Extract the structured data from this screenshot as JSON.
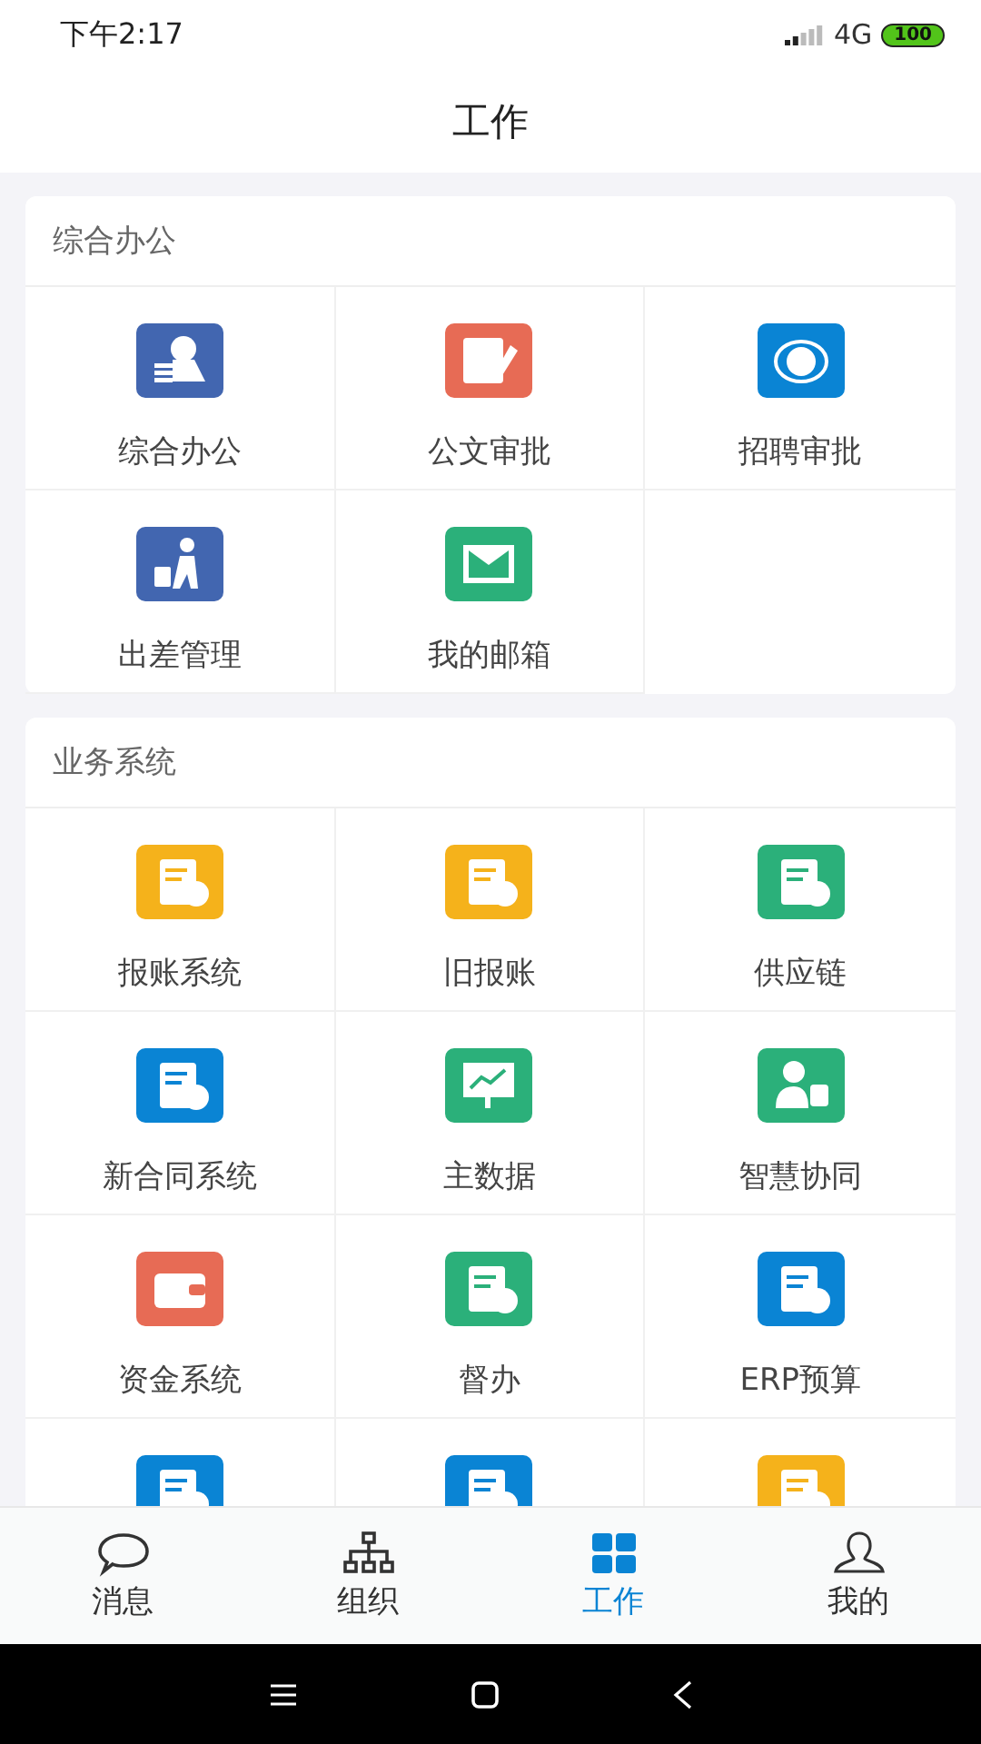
{
  "status_bar": {
    "time": "下午2:17",
    "network": "4G",
    "battery": "100"
  },
  "header": {
    "title": "工作"
  },
  "sections": [
    {
      "title": "综合办公",
      "items": [
        {
          "label": "综合办公",
          "color": "#4266b0"
        },
        {
          "label": "公文审批",
          "color": "#e76b55"
        },
        {
          "label": "招聘审批",
          "color": "#0a84d4"
        },
        {
          "label": "出差管理",
          "color": "#4266b0"
        },
        {
          "label": "我的邮箱",
          "color": "#2bb07a"
        }
      ]
    },
    {
      "title": "业务系统",
      "items": [
        {
          "label": "报账系统",
          "color": "#f5b21b"
        },
        {
          "label": "旧报账",
          "color": "#f5b21b"
        },
        {
          "label": "供应链",
          "color": "#2bb07a"
        },
        {
          "label": "新合同系统",
          "color": "#0a84d4"
        },
        {
          "label": "主数据",
          "color": "#2bb07a"
        },
        {
          "label": "智慧协同",
          "color": "#2bb07a"
        },
        {
          "label": "资金系统",
          "color": "#e76b55"
        },
        {
          "label": "督办",
          "color": "#2bb07a"
        },
        {
          "label": "ERP预算",
          "color": "#0a84d4"
        },
        {
          "color": "#0a84d4"
        },
        {
          "color": "#0a84d4"
        },
        {
          "color": "#f5b21b"
        }
      ]
    }
  ],
  "tabs": [
    {
      "label": "消息",
      "selected": false
    },
    {
      "label": "组织",
      "selected": false
    },
    {
      "label": "工作",
      "selected": true
    },
    {
      "label": "我的",
      "selected": false
    }
  ]
}
